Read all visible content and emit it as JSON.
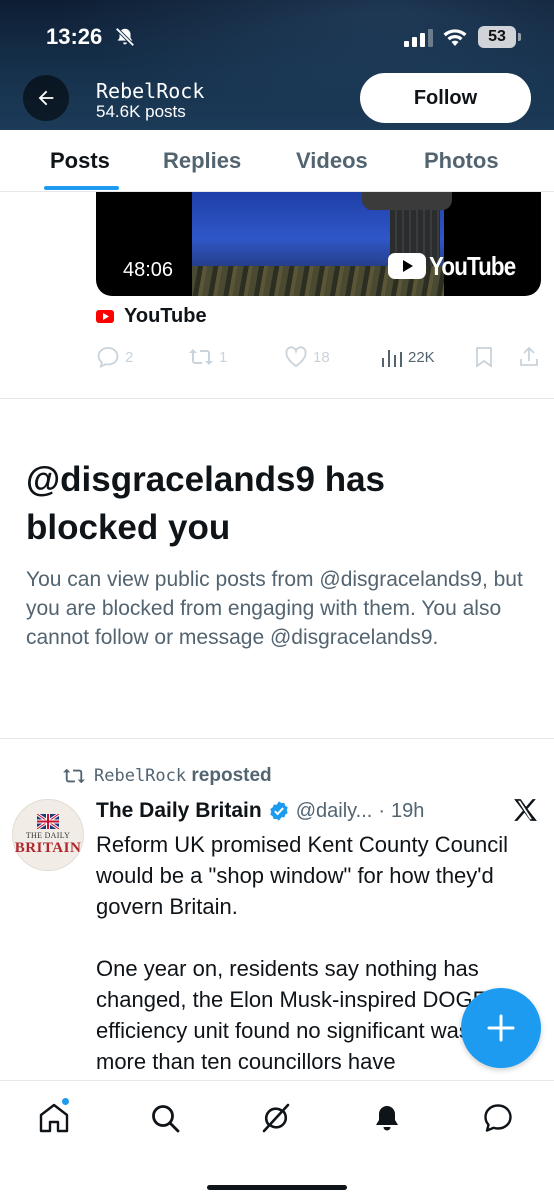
{
  "status_bar": {
    "time": "13:26",
    "battery": "53",
    "icons": [
      "bell-slash-icon",
      "signal-icon",
      "wifi-icon",
      "battery-icon"
    ]
  },
  "profile_header": {
    "name": "RebelRock",
    "posts_count": "54.6K posts",
    "follow_label": "Follow",
    "back_icon": "arrow-left-icon"
  },
  "tabs": [
    {
      "label": "Posts",
      "active": true
    },
    {
      "label": "Replies",
      "active": false
    },
    {
      "label": "Videos",
      "active": false
    },
    {
      "label": "Photos",
      "active": false
    }
  ],
  "video_post": {
    "duration": "48:06",
    "overlay_brand": "YouTube",
    "source_label": "YouTube",
    "actions": {
      "replies": "2",
      "reposts": "1",
      "likes": "18",
      "views": "22K"
    }
  },
  "blocked_notice": {
    "title": "@disgracelands9 has blocked you",
    "body": "You can view public posts from @disgracelands9, but you are blocked from engaging with them. You also cannot follow or message @disgracelands9."
  },
  "repost": {
    "reposter": "RebelRock",
    "verb": "reposted",
    "author_name": "The Daily Britain",
    "handle": "@daily...",
    "separator": "·",
    "time": "19h",
    "avatar_top": "THE DAILY",
    "avatar_bottom": "BRITAIN",
    "text": "Reform UK promised Kent County Council would be a \"shop window\" for how they'd govern Britain.\n\nOne year on, residents say nothing has changed, the Elon Musk-inspired DOGE efficiency unit found no significant waste, more than ten councillors have"
  },
  "colors": {
    "accent": "#1d9bf0",
    "text_primary": "#0f1419",
    "text_secondary": "#536471",
    "verified": "#1d9bf0"
  },
  "bottom_nav": [
    "home-icon",
    "search-icon",
    "grok-icon",
    "notifications-icon",
    "messages-icon"
  ]
}
